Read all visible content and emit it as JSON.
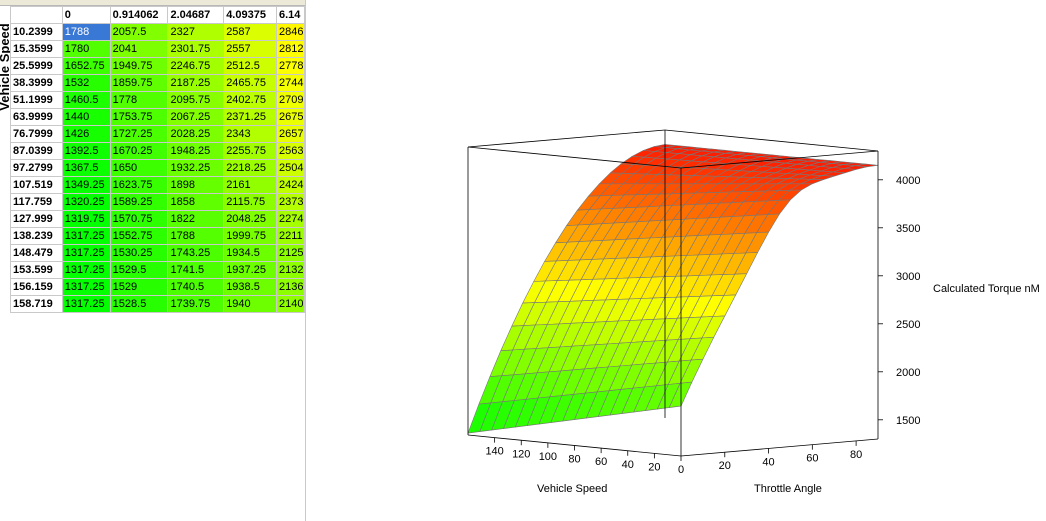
{
  "table": {
    "axis_label": "Vehicle Speed",
    "col_headers": [
      "0",
      "0.914062",
      "2.04687",
      "4.09375",
      "6.14"
    ],
    "rows": [
      {
        "speed": "10.2399",
        "values": [
          "1788",
          "2057.5",
          "2327",
          "2587",
          "2846"
        ]
      },
      {
        "speed": "15.3599",
        "values": [
          "1780",
          "2041",
          "2301.75",
          "2557",
          "2812"
        ]
      },
      {
        "speed": "25.5999",
        "values": [
          "1652.75",
          "1949.75",
          "2246.75",
          "2512.5",
          "2778"
        ]
      },
      {
        "speed": "38.3999",
        "values": [
          "1532",
          "1859.75",
          "2187.25",
          "2465.75",
          "2744"
        ]
      },
      {
        "speed": "51.1999",
        "values": [
          "1460.5",
          "1778",
          "2095.75",
          "2402.75",
          "2709"
        ]
      },
      {
        "speed": "63.9999",
        "values": [
          "1440",
          "1753.75",
          "2067.25",
          "2371.25",
          "2675"
        ]
      },
      {
        "speed": "76.7999",
        "values": [
          "1426",
          "1727.25",
          "2028.25",
          "2343",
          "2657"
        ]
      },
      {
        "speed": "87.0399",
        "values": [
          "1392.5",
          "1670.25",
          "1948.25",
          "2255.75",
          "2563"
        ]
      },
      {
        "speed": "97.2799",
        "values": [
          "1367.5",
          "1650",
          "1932.25",
          "2218.25",
          "2504"
        ]
      },
      {
        "speed": "107.519",
        "values": [
          "1349.25",
          "1623.75",
          "1898",
          "2161",
          "2424"
        ]
      },
      {
        "speed": "117.759",
        "values": [
          "1320.25",
          "1589.25",
          "1858",
          "2115.75",
          "2373"
        ]
      },
      {
        "speed": "127.999",
        "values": [
          "1319.75",
          "1570.75",
          "1822",
          "2048.25",
          "2274"
        ]
      },
      {
        "speed": "138.239",
        "values": [
          "1317.25",
          "1552.75",
          "1788",
          "1999.75",
          "2211"
        ]
      },
      {
        "speed": "148.479",
        "values": [
          "1317.25",
          "1530.25",
          "1743.25",
          "1934.5",
          "2125"
        ]
      },
      {
        "speed": "153.599",
        "values": [
          "1317.25",
          "1529.5",
          "1741.5",
          "1937.25",
          "2132"
        ]
      },
      {
        "speed": "156.159",
        "values": [
          "1317.25",
          "1529",
          "1740.5",
          "1938.5",
          "2136"
        ]
      },
      {
        "speed": "158.719",
        "values": [
          "1317.25",
          "1528.5",
          "1739.75",
          "1940",
          "2140"
        ]
      }
    ],
    "selected_cell": {
      "row": 0,
      "col": 0
    }
  },
  "plot": {
    "z_label": "Calculated Torque nM",
    "x_label": "Vehicle Speed",
    "y_label": "Throttle Angle",
    "z_ticks": [
      "1500",
      "2000",
      "2500",
      "3000",
      "3500",
      "4000"
    ],
    "x_ticks": [
      "20",
      "40",
      "60",
      "80",
      "100",
      "120",
      "140",
      "0"
    ],
    "y_ticks": [
      "20",
      "40",
      "60",
      "80"
    ],
    "colors": {
      "low": "#00ff00",
      "mid": "#ffff00",
      "high": "#ff0000"
    }
  },
  "chart_data": {
    "type": "surface",
    "title": "",
    "xlabel": "Vehicle Speed",
    "ylabel": "Throttle Angle",
    "zlabel": "Calculated Torque nM",
    "zlim": [
      1300,
      4300
    ],
    "xlim": [
      0,
      160
    ],
    "ylim": [
      0,
      90
    ]
  }
}
